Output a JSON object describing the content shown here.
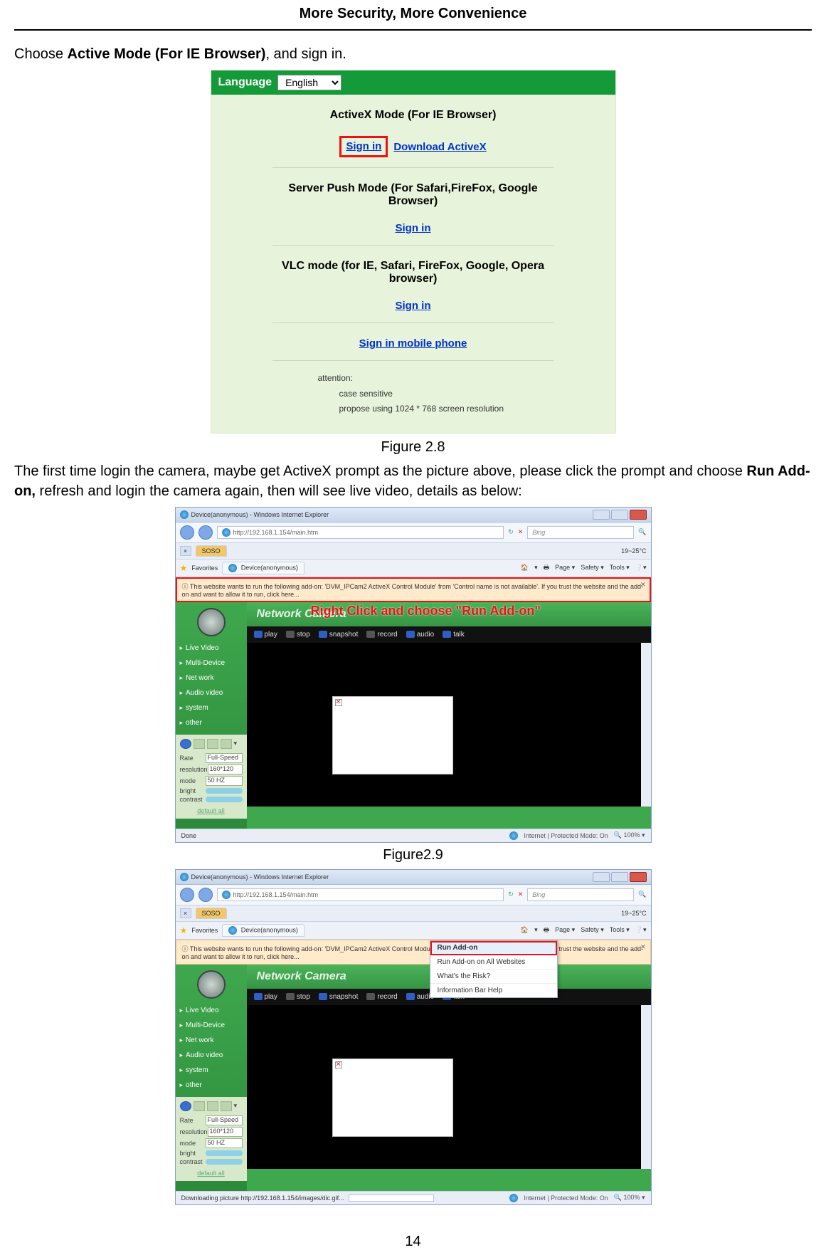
{
  "header": {
    "title": "More Security, More Convenience"
  },
  "instruction1": {
    "pre": "Choose ",
    "bold": "Active Mode (For IE Browser)",
    "post": ", and sign in."
  },
  "fig28": {
    "language_label": "Language",
    "language_value": "English",
    "activex": {
      "title": "ActiveX Mode (For IE Browser)",
      "signin": "Sign in",
      "download": "Download ActiveX"
    },
    "push": {
      "title": "Server Push Mode (For Safari,FireFox, Google Browser)",
      "signin": "Sign in"
    },
    "vlc": {
      "title": "VLC mode (for IE, Safari, FireFox, Google, Opera browser)",
      "signin": "Sign in"
    },
    "mobile": {
      "signin": "Sign in mobile phone"
    },
    "attention": {
      "label": "attention:",
      "line1": "case sensitive",
      "line2": "propose using 1024 * 768 screen resolution"
    },
    "caption": "Figure 2.8"
  },
  "para2": {
    "pre": "The first time login the camera, maybe get ActiveX prompt as the picture above, please click the prompt and choose ",
    "bold": "Run Add-on,",
    "post": " refresh and login the camera again, then will see live video, details as below:"
  },
  "ie_common": {
    "window_title": "Device(anonymous) - Windows Internet Explorer",
    "url": "http://192.168.1.154/main.htm",
    "search_placeholder": "Bing",
    "tab_title": "Device(anonymous)",
    "favorites": "Favorites",
    "toolbar_temp": "19~25°C",
    "toolbar_right": [
      "Page ▾",
      "Safety ▾",
      "Tools ▾"
    ],
    "infobar_text": "This website wants to run the following add-on: 'DVM_IPCam2 ActiveX Control Module' from 'Control name is not available'. If you trust the website and the add-on and want to allow it to run, click here...",
    "network_camera": "Network Camera",
    "menu": [
      "Live Video",
      "Multi-Device",
      "Net work",
      "Audio video",
      "system",
      "other"
    ],
    "toolbar_video": [
      "play",
      "stop",
      "snapshot",
      "record",
      "audio",
      "talk"
    ],
    "ctrl": {
      "rate_label": "Rate",
      "rate_value": "Full-Speed",
      "res_label": "resolution",
      "res_value": "160*120",
      "mode_label": "mode",
      "mode_value": "50 HZ",
      "bright_label": "bright",
      "contrast_label": "contrast",
      "default": "default all"
    },
    "status_protected": "Internet | Protected Mode: On",
    "zoom": "100%"
  },
  "fig29": {
    "overlay": "Right Click and choose \"Run Add-on\"",
    "status_left": "Done",
    "caption": "Figure2.9"
  },
  "fig210": {
    "status_left": "Downloading picture http://192.168.1.154/images/dic.gif...",
    "context_menu": [
      "Run Add-on",
      "Run Add-on on All Websites",
      "What's the Risk?",
      "Information Bar Help"
    ]
  },
  "page_number": "14"
}
